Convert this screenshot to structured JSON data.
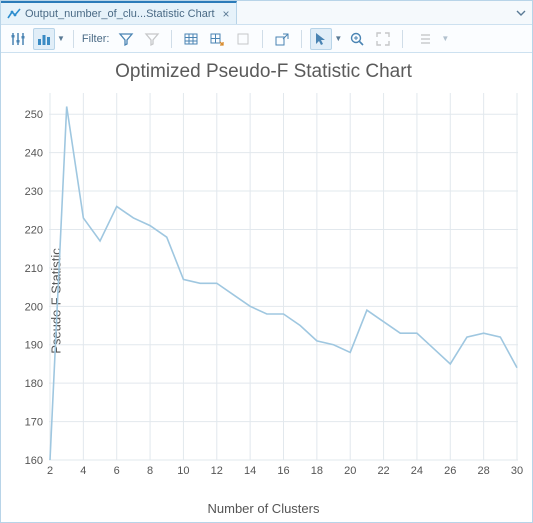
{
  "tab": {
    "label": "Output_number_of_clu...Statistic Chart",
    "close": "×"
  },
  "toolbar": {
    "filter_label": "Filter:"
  },
  "chart": {
    "title": "Optimized Pseudo-F Statistic Chart",
    "xlabel": "Number of Clusters",
    "ylabel": "Pseudo-F Statistic"
  },
  "chart_data": {
    "type": "line",
    "x": [
      2,
      3,
      4,
      5,
      6,
      7,
      8,
      9,
      10,
      11,
      12,
      13,
      14,
      15,
      16,
      17,
      18,
      19,
      20,
      21,
      22,
      23,
      24,
      25,
      26,
      27,
      28,
      29,
      30
    ],
    "values": [
      160,
      252,
      223,
      217,
      226,
      223,
      221,
      218,
      207,
      206,
      206,
      203,
      200,
      198,
      198,
      195,
      191,
      190,
      188,
      199,
      196,
      193,
      193,
      189,
      185,
      192,
      193,
      192,
      184
    ],
    "title": "Optimized Pseudo-F Statistic Chart",
    "xlabel": "Number of Clusters",
    "ylabel": "Pseudo-F Statistic",
    "xlim": [
      2,
      30
    ],
    "ylim": [
      160,
      255
    ],
    "x_ticks": [
      2,
      4,
      6,
      8,
      10,
      12,
      14,
      16,
      18,
      20,
      22,
      24,
      26,
      28,
      30
    ],
    "y_ticks": [
      160,
      170,
      180,
      190,
      200,
      210,
      220,
      230,
      240,
      250
    ]
  }
}
